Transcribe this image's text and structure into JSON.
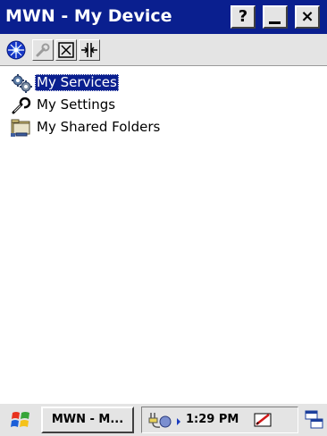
{
  "window": {
    "title": "MWN - My Device",
    "help_label": "?",
    "minimize_label": "_",
    "close_label": "×"
  },
  "toolbar": {
    "items": [
      {
        "icon": "globe-icon"
      },
      {
        "icon": "wrench-icon"
      },
      {
        "icon": "box-x-icon"
      },
      {
        "icon": "split-icon"
      }
    ]
  },
  "tree": {
    "items": [
      {
        "label": "My Services",
        "icon": "gears-icon",
        "selected": true
      },
      {
        "label": "My Settings",
        "icon": "wrench-icon",
        "selected": false
      },
      {
        "label": "My Shared Folders",
        "icon": "shared-folder-icon",
        "selected": false
      }
    ]
  },
  "taskbar": {
    "task_label": "MWN - M...",
    "clock": "1:29 PM"
  },
  "colors": {
    "titlebar": "#0a1f8f",
    "selection": "#0a1f8f",
    "chrome": "#e4e4e4"
  }
}
